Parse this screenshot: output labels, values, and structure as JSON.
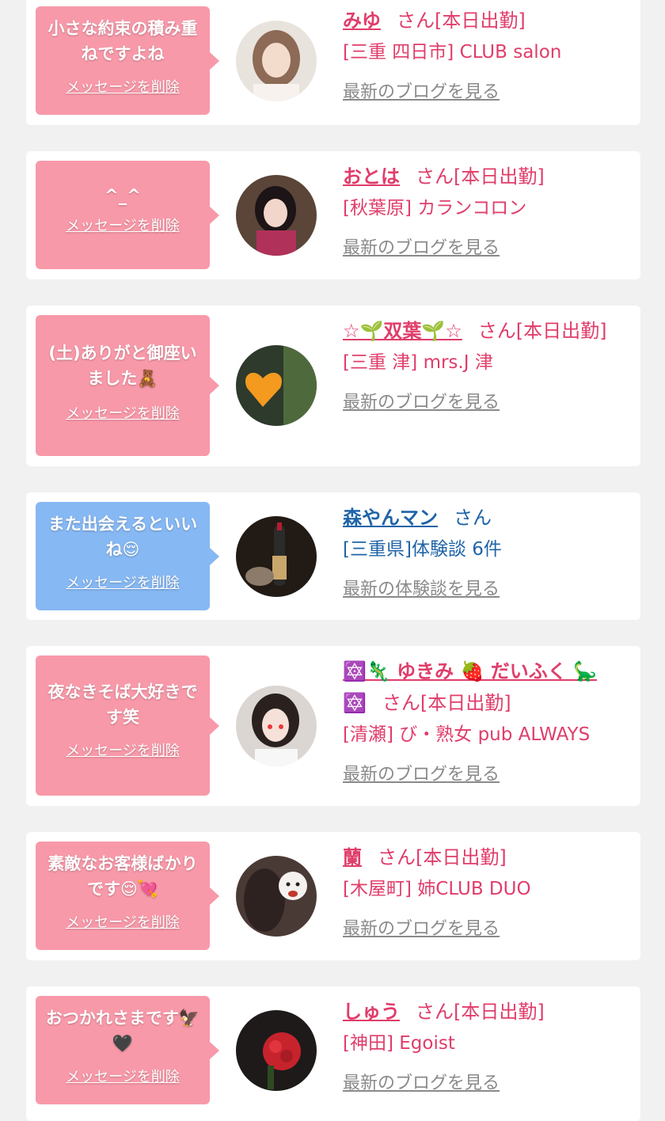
{
  "delete_label": "メッセージを削除",
  "colors": {
    "pink_bubble": "#f899a9",
    "blue_bubble": "#86b8f3",
    "girl_text": "#e03d6a",
    "user_text": "#1f64a8"
  },
  "cards": [
    {
      "message": "小さな約束の積み重ねですよね",
      "name": "みゆ",
      "suffix": "さん[本日出勤]",
      "shop": "[三重 四日市] CLUB salon",
      "link": "最新のブログを見る",
      "avatar_icon": "portrait-photo"
    },
    {
      "message": "^_^",
      "name": "おとは",
      "suffix": "さん[本日出勤]",
      "shop": "[秋葉原] カランコロン",
      "link": "最新のブログを見る",
      "avatar_icon": "portrait-photo"
    },
    {
      "message": "(土)ありがと御座いました🧸",
      "name": "☆🌱双葉🌱☆",
      "suffix": "さん[本日出勤]",
      "shop": "[三重 津] mrs.J 津",
      "link": "最新のブログを見る",
      "avatar_icon": "heart-covered-photo"
    },
    {
      "message": "また出会えるといいね😌",
      "name": "森やんマン",
      "suffix": "さん",
      "shop": "[三重県]体験談 6件",
      "link": "最新の体験談を見る",
      "avatar_icon": "champagne-photo"
    },
    {
      "message": "夜なきそば大好きです笑",
      "name": "🔯🦎 ゆきみ 🍓 だいふく 🦕",
      "name_tail": "🔯",
      "suffix": "さん[本日出勤]",
      "shop": "[清瀬] び・熟女 pub ALWAYS",
      "link": "最新のブログを見る",
      "avatar_icon": "portrait-photo"
    },
    {
      "message": "素敵なお客様ばかりです😌💘",
      "name": "蘭",
      "suffix": "さん[本日出勤]",
      "shop": "[木屋町] 姉CLUB DUO",
      "link": "最新のブログを見る",
      "avatar_icon": "dog-photo"
    },
    {
      "message": "おつかれさまです🦅🖤",
      "name": "しゅう",
      "suffix": "さん[本日出勤]",
      "shop": "[神田] Egoist",
      "link": "最新のブログを見る",
      "avatar_icon": "roses-photo"
    }
  ]
}
